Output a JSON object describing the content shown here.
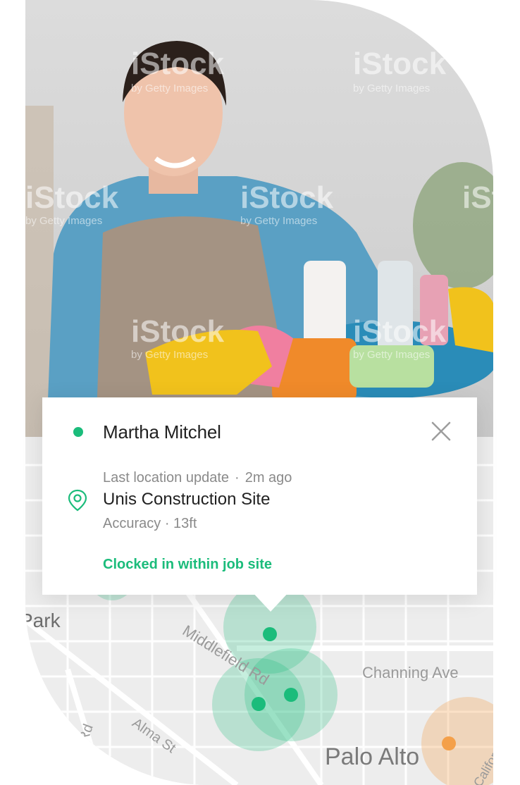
{
  "popup": {
    "name": "Martha Mitchel",
    "last_update_label": "Last location update",
    "separator": "·",
    "last_update_time": "2m ago",
    "site_name": "Unis Construction Site",
    "accuracy_label": "Accuracy",
    "accuracy_value": "13ft",
    "status_text": "Clocked in within job site",
    "status_color": "#1bbc7b"
  },
  "photo": {
    "watermark": "iStock",
    "watermark_sub": "by Getty Images"
  },
  "map": {
    "labels": {
      "park": "Park",
      "middlefield": "Middlefield Rd",
      "channing": "Channing Ave",
      "alma": "Alma St",
      "hill": "Hill Rd",
      "palo_alto": "Palo Alto",
      "california": "California"
    },
    "colors": {
      "zone": "#1bbc7b",
      "orange": "#f4a04a",
      "road": "#ffffff",
      "land": "#ededed"
    }
  },
  "icons": {
    "status": "status-dot",
    "close": "close-icon",
    "location": "location-pin-icon"
  }
}
